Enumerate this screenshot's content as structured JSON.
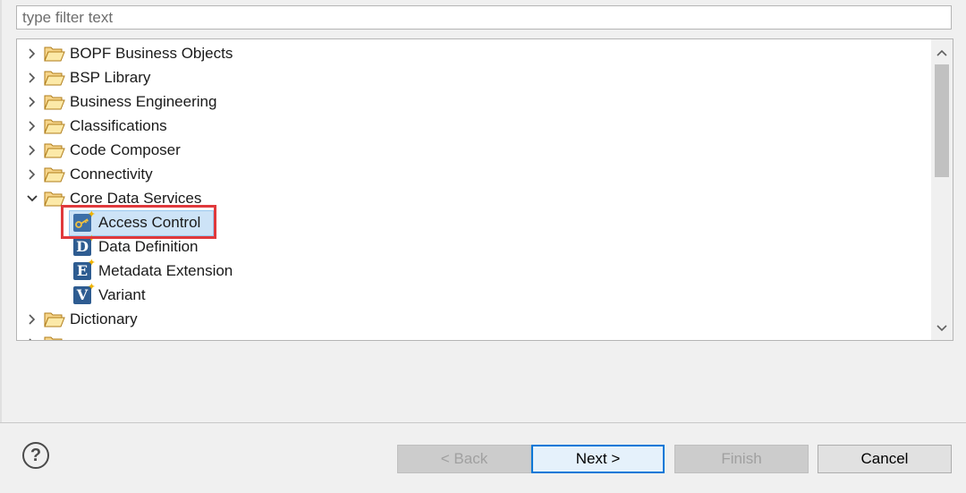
{
  "filter": {
    "placeholder": "type filter text"
  },
  "tree": {
    "items": [
      {
        "label": "BOPF Business Objects",
        "type": "folder",
        "expanded": false
      },
      {
        "label": "BSP Library",
        "type": "folder",
        "expanded": false
      },
      {
        "label": "Business Engineering",
        "type": "folder",
        "expanded": false
      },
      {
        "label": "Classifications",
        "type": "folder",
        "expanded": false
      },
      {
        "label": "Code Composer",
        "type": "folder",
        "expanded": false
      },
      {
        "label": "Connectivity",
        "type": "folder",
        "expanded": false
      },
      {
        "label": "Core Data Services",
        "type": "folder",
        "expanded": true
      },
      {
        "label": "Access Control",
        "type": "leaf",
        "icon": "access-control-icon",
        "selected": true
      },
      {
        "label": "Data Definition",
        "type": "leaf",
        "icon": "data-definition-icon"
      },
      {
        "label": "Metadata Extension",
        "type": "leaf",
        "icon": "metadata-extension-icon"
      },
      {
        "label": "Variant",
        "type": "leaf",
        "icon": "variant-icon"
      },
      {
        "label": "Dictionary",
        "type": "folder",
        "expanded": false
      }
    ]
  },
  "buttons": {
    "back": "< Back",
    "next": "Next >",
    "finish": "Finish",
    "cancel": "Cancel"
  },
  "colors": {
    "highlight_border": "#e0393c",
    "selection_bg": "#cde3f7",
    "folder": "#e8b74a",
    "cds_icon": "#2e5c91"
  }
}
